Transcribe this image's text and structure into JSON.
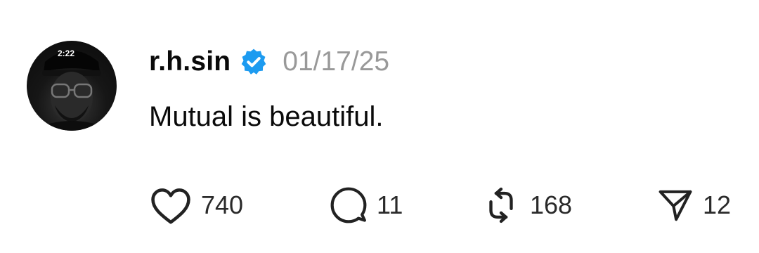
{
  "post": {
    "avatar_badge": "2:22",
    "username": "r.h.sin",
    "verified_icon": "verified-badge-icon",
    "timestamp": "01/17/25",
    "text": "Mutual is beautiful.",
    "accent_color": "#1D9BF0",
    "actions": {
      "like": {
        "icon": "heart-icon",
        "count": "740"
      },
      "reply": {
        "icon": "comment-bubble-icon",
        "count": "11"
      },
      "repost": {
        "icon": "repost-icon",
        "count": "168"
      },
      "share": {
        "icon": "send-icon",
        "count": "12"
      }
    }
  }
}
